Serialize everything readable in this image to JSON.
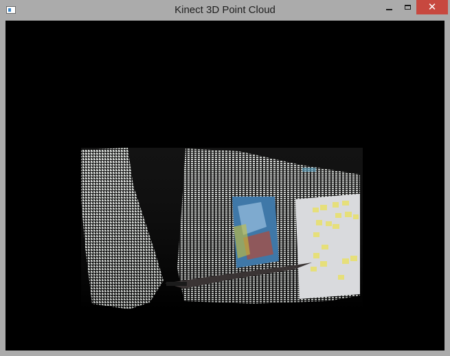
{
  "window": {
    "title": "Kinect 3D Point Cloud",
    "controls": {
      "minimize_icon": "minimize-icon",
      "maximize_icon": "maximize-icon",
      "close_icon": "close-icon",
      "close_glyph": "✕"
    },
    "colors": {
      "frame": "#ababab",
      "close_button": "#c7483f",
      "viewport_background": "#000000"
    }
  },
  "viewport": {
    "content": "point-cloud-render"
  }
}
